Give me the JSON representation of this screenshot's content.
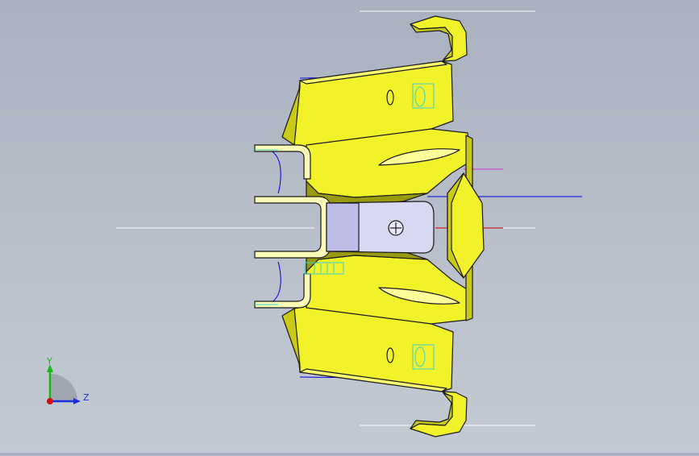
{
  "viewport": {
    "background_top": "#a9b1bf",
    "background_bottom": "#c4cad3",
    "model_color": "#f2f22a",
    "model_shadow": "#c9c918",
    "edge_color": "#1a1a1a",
    "selection_color": "#3ad0d0",
    "sketch_blue": "#0000d8",
    "sketch_red": "#d00000",
    "sketch_magenta": "#d030d0",
    "slot_color": "#d8d8f2"
  },
  "triad": {
    "y_label": "Y",
    "z_label": "Z",
    "y_color": "#18b818",
    "z_color": "#1a30e0",
    "x_color": "#d01010"
  }
}
